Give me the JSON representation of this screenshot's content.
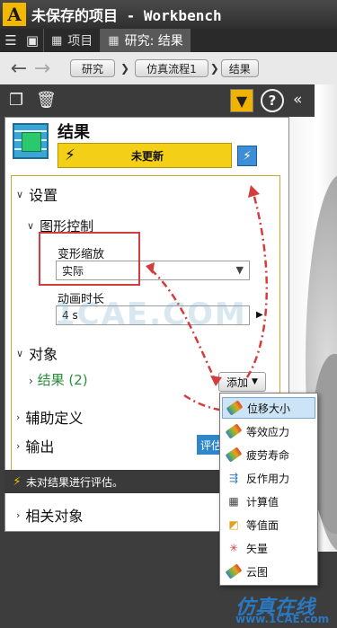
{
  "window": {
    "title": "未保存的项目 - Workbench",
    "logo_letter": "A"
  },
  "tabs": [
    {
      "label": "项目",
      "active": false
    },
    {
      "label": "研究: 结果",
      "active": true
    }
  ],
  "breadcrumb": [
    "研究",
    "仿真流程1",
    "结果"
  ],
  "panel": {
    "title": "结果",
    "status": "未更新",
    "sections": {
      "settings": "设置",
      "graphics": "图形控制",
      "deformation_label": "变形缩放",
      "deformation_value": "实际",
      "anim_label": "动画时长",
      "anim_value": "4 s",
      "objects": "对象",
      "results_link": "结果 (2)",
      "add_button": "添加",
      "aux": "辅助定义",
      "output": "输出",
      "eval_button": "评估",
      "notice": "未对结果进行评估。",
      "related": "相关对象"
    }
  },
  "menu": {
    "items": [
      {
        "label": "位移大小",
        "icon": "displacement-icon",
        "color": "#e8a020",
        "selected": true
      },
      {
        "label": "等效应力",
        "icon": "stress-icon",
        "color": "#d9482b"
      },
      {
        "label": "疲劳寿命",
        "icon": "fatigue-icon",
        "color": "#6bb54a"
      },
      {
        "label": "反作用力",
        "icon": "reaction-force-icon",
        "color": "#3a7ec2"
      },
      {
        "label": "计算值",
        "icon": "calculator-icon",
        "color": "#555555"
      },
      {
        "label": "等值面",
        "icon": "isosurface-icon",
        "color": "#e0a320"
      },
      {
        "label": "矢量",
        "icon": "vector-icon",
        "color": "#d04040"
      },
      {
        "label": "云图",
        "icon": "contour-icon",
        "color": "#3ca0d8"
      }
    ]
  },
  "watermark": {
    "center": "1CAE.COM",
    "corner": "仿真在线",
    "url": "www.1CAE.com"
  },
  "colors": {
    "accent_yellow": "#f3cf17",
    "annotation_red": "#d33d3d",
    "link_green": "#2a8c3a"
  }
}
